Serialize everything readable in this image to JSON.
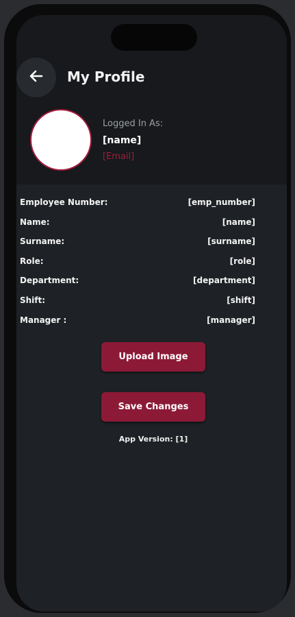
{
  "header": {
    "title": "My Profile",
    "back_icon": "arrow-left-icon"
  },
  "user": {
    "logged_in_label": "Logged In As:",
    "name": "[name]",
    "email": "[Email]"
  },
  "details": [
    {
      "label": "Employee Number:",
      "value": "[emp_number]"
    },
    {
      "label": "Name:",
      "value": "[name]"
    },
    {
      "label": "Surname:",
      "value": "[surname]"
    },
    {
      "label": "Role:",
      "value": "[role]"
    },
    {
      "label": "Department:",
      "value": "[department]"
    },
    {
      "label": "Shift:",
      "value": "[shift]"
    },
    {
      "label": "Manager :",
      "value": "[manager]"
    }
  ],
  "actions": {
    "upload_label": "Upload Image",
    "save_label": "Save Changes"
  },
  "footer": {
    "version_text": "App Version: [1]"
  },
  "colors": {
    "accent": "#8c1a37",
    "background": "#1e2125",
    "header_bg": "#17191c",
    "email": "#9c1f3d"
  }
}
